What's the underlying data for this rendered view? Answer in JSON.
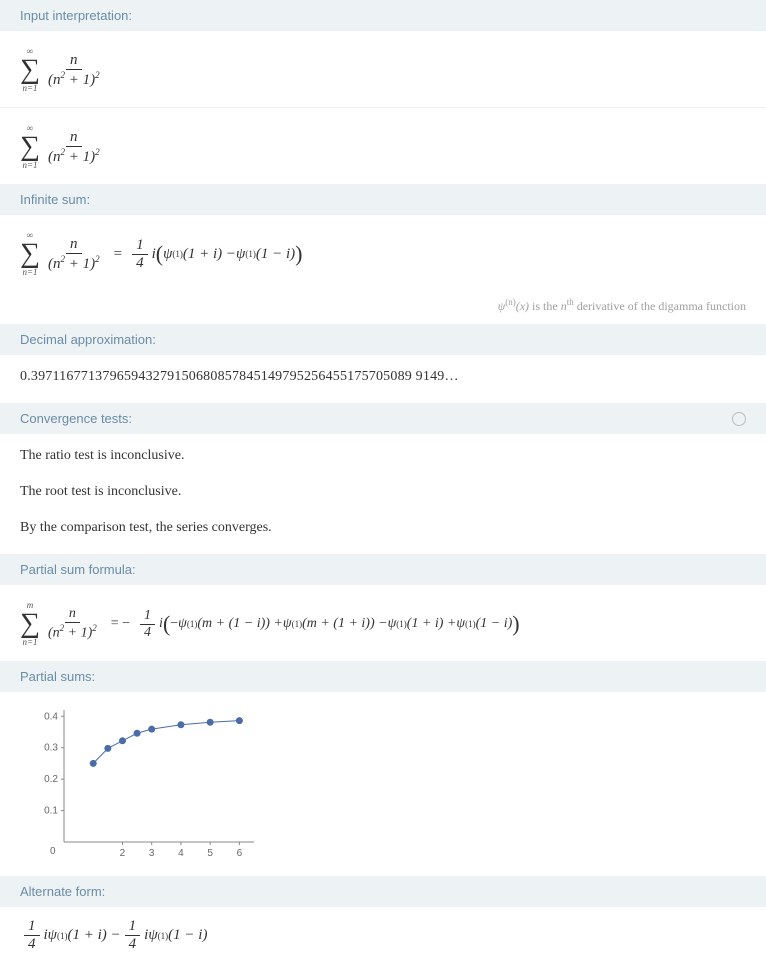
{
  "sections": {
    "input_interpretation": "Input interpretation:",
    "infinite_sum": "Infinite sum:",
    "decimal_approx": "Decimal approximation:",
    "convergence": "Convergence tests:",
    "partial_formula": "Partial sum formula:",
    "partial_sums": "Partial sums:",
    "alternate_form": "Alternate form:"
  },
  "summand": {
    "upper": "∞",
    "lower": "n=1",
    "num": "n",
    "den_base": "(n",
    "den_plus": " + 1)",
    "den_exp_inner": "2",
    "den_exp_outer": "2"
  },
  "infinite_sum": {
    "equals": " = ",
    "coef_num": "1",
    "coef_den": "4",
    "i": " i ",
    "psi1a": "ψ",
    "order": "(1)",
    "arg1": "(1 + i) − ",
    "psi1b": "ψ",
    "arg2": "(1 − i)"
  },
  "footnote": {
    "psi": "ψ",
    "sup": "(n)",
    "x": "(x)",
    "text_is": " is the ",
    "n": "n",
    "th": "th",
    "text_rest": " derivative of the digamma function"
  },
  "decimal": "0.39711677137965943279150680857845149795256455175705089 9149…",
  "tests": {
    "ratio": "The ratio test is inconclusive.",
    "root": "The root test is inconclusive.",
    "comparison": "By the comparison test, the series converges."
  },
  "partial_formula": {
    "upper": "m",
    "lower": "n=1",
    "num": "n",
    "equals": " = − ",
    "coef_num": "1",
    "coef_den": "4",
    "i": " i ",
    "lparen": "(",
    "neg": "−",
    "psi": "ψ",
    "order": "(1)",
    "arg1": "(m + (1 − i)) + ",
    "arg2": "(m + (1 + i)) − ",
    "arg3": "(1 + i) + ",
    "arg4": "(1 − i)",
    "rparen": ")"
  },
  "alternate": {
    "coef_num": "1",
    "coef_den": "4",
    "i": " i ",
    "psi": "ψ",
    "order": "(1)",
    "arg1": "(1 + i) − ",
    "arg2": "(1 − i)"
  },
  "chart_data": {
    "type": "scatter",
    "x": [
      1,
      1.5,
      2,
      2.5,
      3,
      4,
      5,
      6
    ],
    "y": [
      0.25,
      0.298,
      0.322,
      0.346,
      0.359,
      0.373,
      0.381,
      0.386
    ],
    "xlabel": "",
    "ylabel": "",
    "xlim": [
      0,
      6.5
    ],
    "ylim": [
      0,
      0.42
    ],
    "xticks": [
      0,
      2,
      3,
      4,
      5,
      6
    ],
    "yticks": [
      0.1,
      0.2,
      0.3,
      0.4
    ]
  }
}
